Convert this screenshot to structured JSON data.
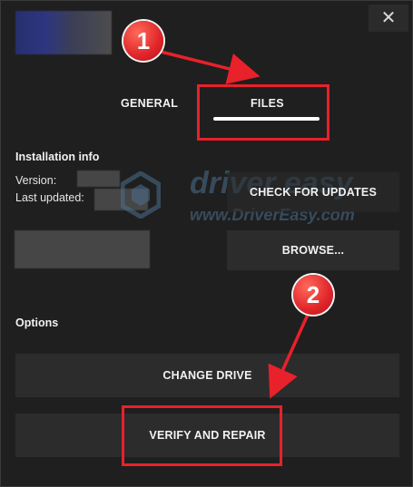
{
  "window": {
    "close_icon": "close-icon"
  },
  "tabs": [
    {
      "label": "GENERAL"
    },
    {
      "label": "FILES"
    }
  ],
  "installation": {
    "title": "Installation info",
    "version_label": "Version:",
    "last_updated_label": "Last updated:"
  },
  "buttons": {
    "check_updates": "CHECK FOR UPDATES",
    "browse": "BROWSE...",
    "change_drive": "CHANGE DRIVE",
    "verify_repair": "VERIFY AND REPAIR"
  },
  "options": {
    "title": "Options"
  },
  "watermark": {
    "brand": "driver easy",
    "url": "www.DriverEasy.com"
  },
  "annotations": {
    "step1": "1",
    "step2": "2",
    "highlight_color": "#e8212b"
  }
}
